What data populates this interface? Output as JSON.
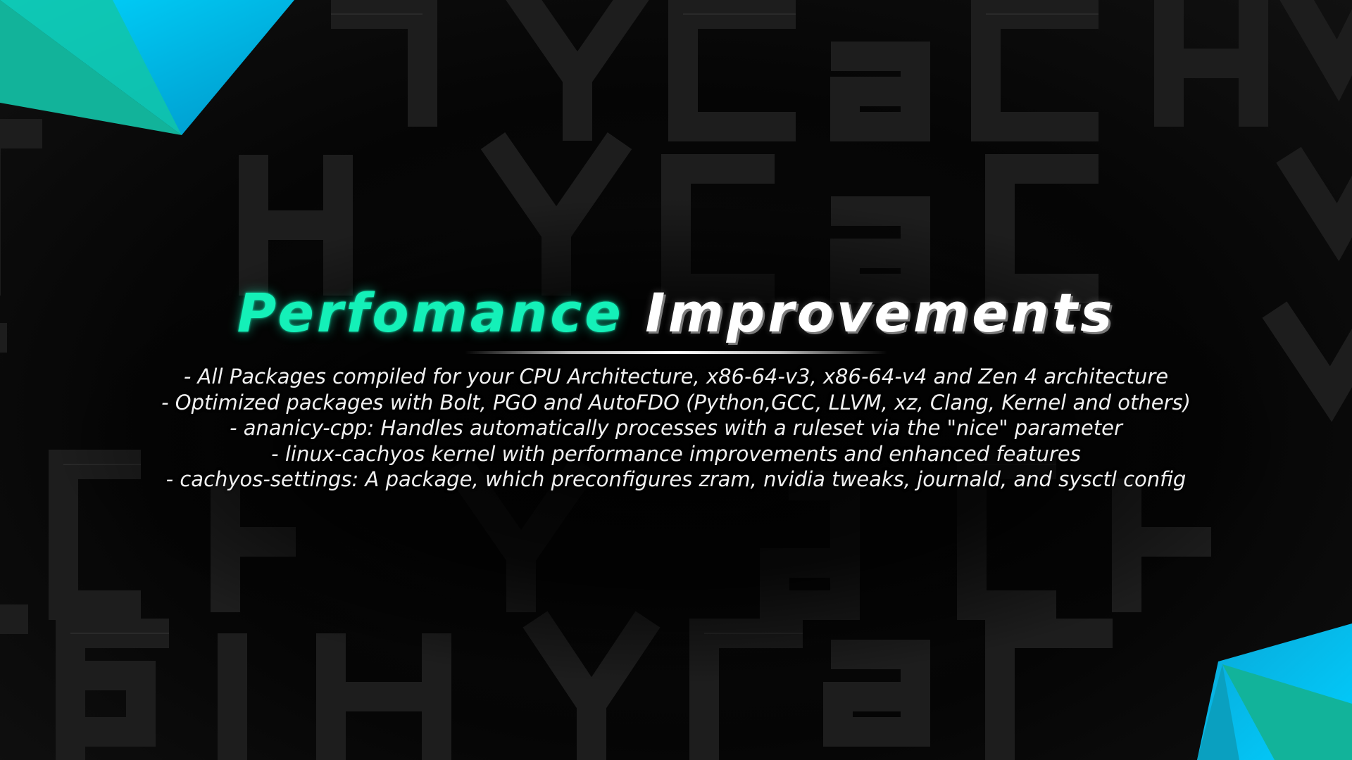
{
  "slide": {
    "title_accent": "Perfomance",
    "title_main": "Improvements",
    "features": [
      "- All Packages compiled for your CPU Architecture, x86-64-v3, x86-64-v4 and Zen 4 architecture",
      "- Optimized packages with Bolt, PGO and AutoFDO (Python,GCC, LLVM, xz, Clang, Kernel and others)",
      "- ananicy-cpp: Handles automatically processes with a ruleset via the \"nice\" parameter",
      "- linux-cachyos kernel with performance improvements and enhanced features",
      "- cachyos-settings: A package, which preconfigures zram, nvidia tweaks, journald, and sysctl config"
    ]
  },
  "background": {
    "pattern_text": "cachy",
    "colors": {
      "base": "#050505",
      "accent_green": "#14f0b8",
      "accent_cyan": "#00c8f0",
      "teal": "#12b39a"
    }
  }
}
